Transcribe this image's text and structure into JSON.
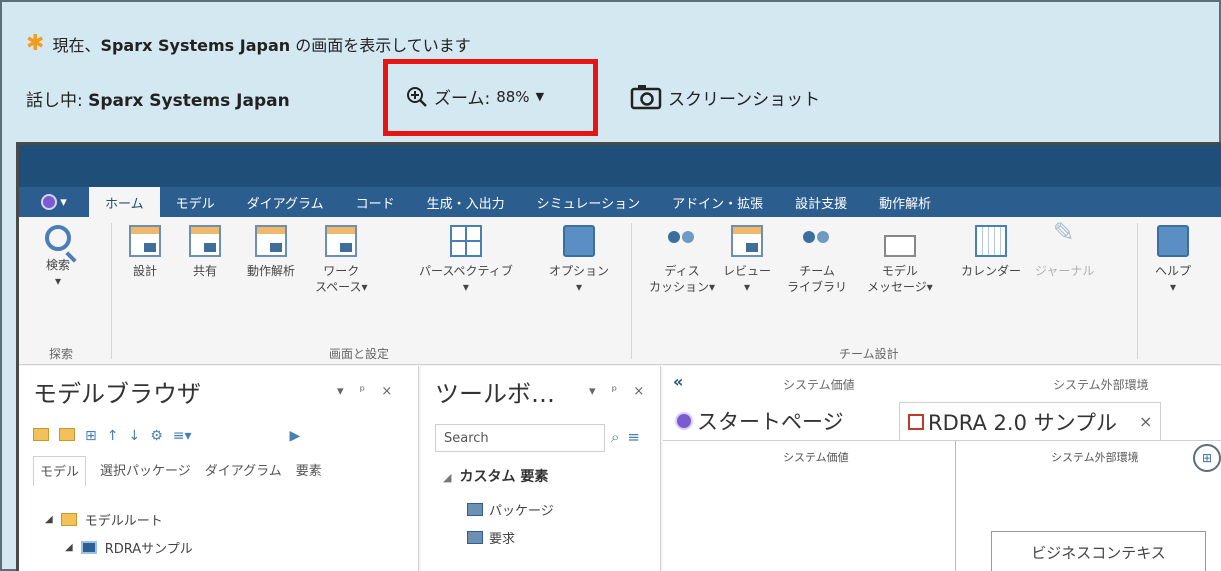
{
  "share_bar": {
    "status_prefix": "現在、",
    "status_presenter": "Sparx Systems Japan",
    "status_suffix": " の画面を表示しています",
    "speaking_label": "話し中: ",
    "speaking_name": "Sparx Systems Japan",
    "zoom_label": "ズーム: ",
    "zoom_value": "88%",
    "screenshot_label": "スクリーンショット",
    "highlight_color": "#e81414"
  },
  "ribbon": {
    "tabs": [
      "ホーム",
      "モデル",
      "ダイアグラム",
      "コード",
      "生成・入出力",
      "シミュレーション",
      "アドイン・拡張",
      "設計支援",
      "動作解析"
    ],
    "active_tab": "ホーム",
    "buttons": {
      "search": "検索",
      "design": "設計",
      "share": "共有",
      "behavior": "動作解析",
      "workspace_1": "ワーク",
      "workspace_2": "スペース▾",
      "perspective": "パースペクティブ",
      "options": "オプション",
      "discussion_1": "ディス",
      "discussion_2": "カッション▾",
      "review": "レビュー",
      "team_1": "チーム",
      "team_2": "ライブラリ",
      "model_msg_1": "モデル",
      "model_msg_2": "メッセージ▾",
      "calendar": "カレンダー",
      "journal": "ジャーナル",
      "help": "ヘルプ"
    },
    "groups": {
      "search": "探索",
      "screen": "画面と設定",
      "team": "チーム設計"
    }
  },
  "model_browser": {
    "title": "モデルブラウザ",
    "controls": "▾ ᵖ ×",
    "tabs": [
      "モデル",
      "選択パッケージ",
      "ダイアグラム",
      "要素"
    ],
    "tree": [
      {
        "label": "モデルルート"
      },
      {
        "label": "RDRAサンプル"
      }
    ]
  },
  "toolbox": {
    "title": "ツールボ…",
    "controls": "▾ ᵖ ×",
    "search_placeholder": "Search",
    "section": "カスタム 要素",
    "items": [
      "パッケージ",
      "要求"
    ]
  },
  "diagram": {
    "header_cols": [
      "システム価値",
      "システム外部環境"
    ],
    "tabs": [
      {
        "label": "スタートページ"
      },
      {
        "label": "RDRA 2.0 サンプル",
        "close": "×"
      }
    ],
    "canvas_cols": [
      "システム価値",
      "システム外部環境"
    ],
    "box_label": "ビジネスコンテキス"
  }
}
